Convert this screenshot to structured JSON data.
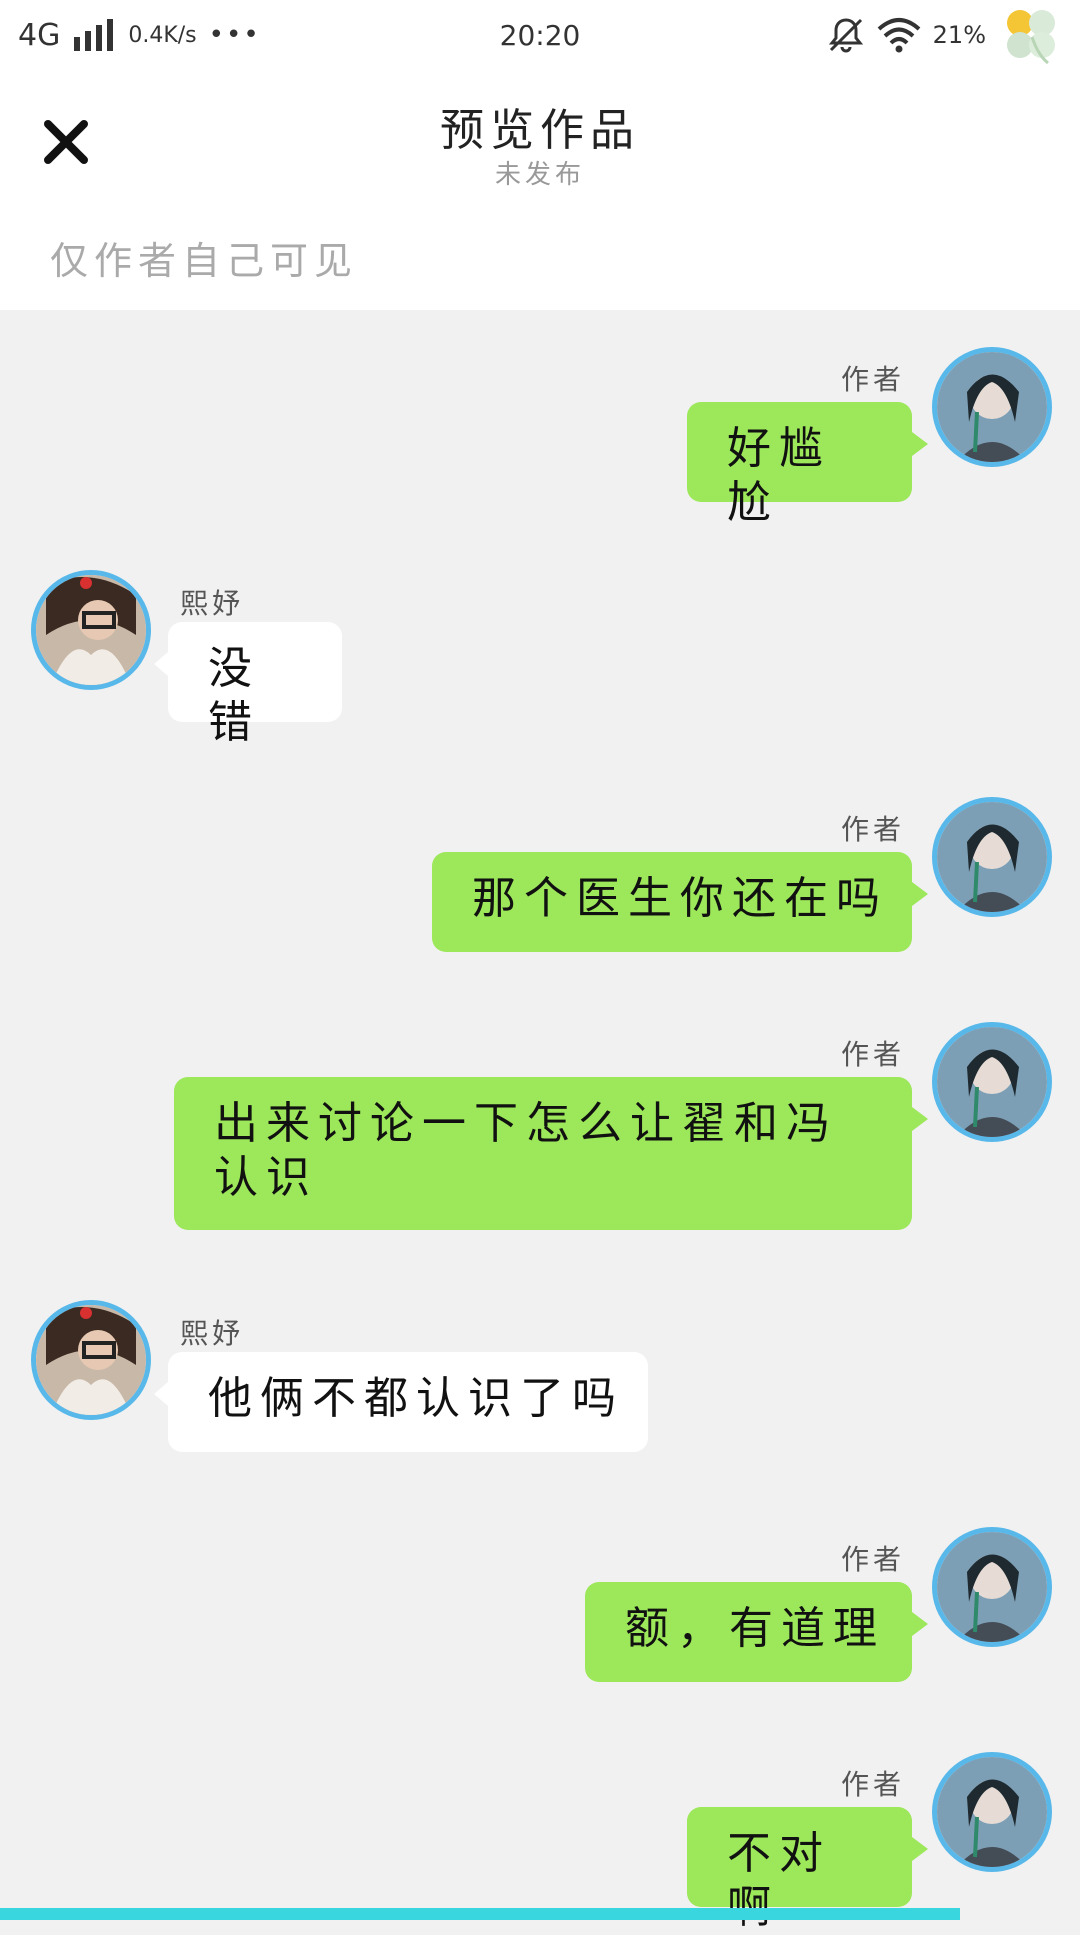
{
  "status_bar": {
    "network": "4G",
    "speed": "0.4K/s",
    "more": "•••",
    "time": "20:20",
    "battery": "21%"
  },
  "header": {
    "title": "预览作品",
    "subtitle": "未发布",
    "visibility_note": "仅作者自己可见"
  },
  "colors": {
    "right_bubble": "#9de75a",
    "left_bubble": "#ffffff",
    "avatar_ring": "#59b8ea",
    "background": "#f1f1f1"
  },
  "messages": [
    {
      "side": "right",
      "name": "作者",
      "text": "好尴尬"
    },
    {
      "side": "left",
      "name": "熙妤",
      "text": "没错"
    },
    {
      "side": "right",
      "name": "作者",
      "text": "那个医生你还在吗"
    },
    {
      "side": "right",
      "name": "作者",
      "text": "出来讨论一下怎么让翟和冯认识"
    },
    {
      "side": "left",
      "name": "熙妤",
      "text": "他俩不都认识了吗"
    },
    {
      "side": "right",
      "name": "作者",
      "text": "额，有道理"
    },
    {
      "side": "right",
      "name": "作者",
      "text": "不对啊"
    }
  ]
}
